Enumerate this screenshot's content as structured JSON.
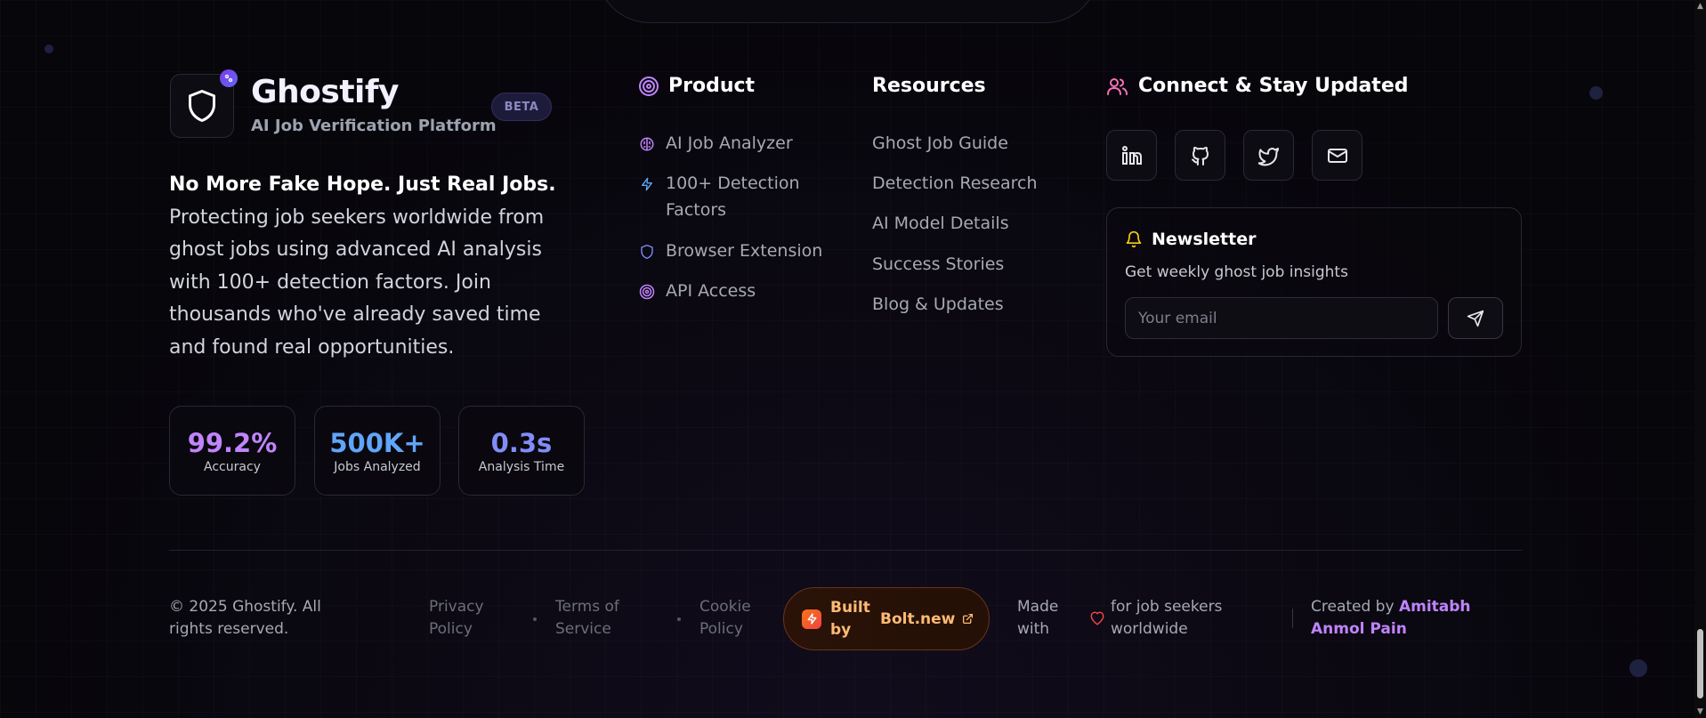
{
  "brand": {
    "name": "Ghostify",
    "tagline": "AI Job Verification Platform",
    "beta": "BETA",
    "headline": "No More Fake Hope. Just Real Jobs.",
    "description": "Protecting job seekers worldwide from ghost jobs using advanced AI analysis with 100+ detection factors. Join thousands who've already saved time and found real opportunities."
  },
  "stats": [
    {
      "value": "99.2%",
      "label": "Accuracy",
      "color": "#c084fc"
    },
    {
      "value": "500K+",
      "label": "Jobs Analyzed",
      "color": "#60a5fa"
    },
    {
      "value": "0.3s",
      "label": "Analysis Time",
      "color": "#818cf8"
    }
  ],
  "product": {
    "title": "Product",
    "items": [
      {
        "label": "AI Job Analyzer",
        "icon": "brain-icon"
      },
      {
        "label": "100+ Detection Factors",
        "icon": "zap-icon"
      },
      {
        "label": "Browser Extension",
        "icon": "shield-icon"
      },
      {
        "label": "API Access",
        "icon": "target-icon"
      }
    ]
  },
  "resources": {
    "title": "Resources",
    "items": [
      "Ghost Job Guide",
      "Detection Research",
      "AI Model Details",
      "Success Stories",
      "Blog & Updates"
    ]
  },
  "connect": {
    "title": "Connect & Stay Updated",
    "socials": [
      "linkedin-icon",
      "github-icon",
      "twitter-icon",
      "mail-icon"
    ]
  },
  "newsletter": {
    "title": "Newsletter",
    "subtitle": "Get weekly ghost job insights",
    "placeholder": "Your email"
  },
  "footer": {
    "copyright": "© 2025 Ghostify. All rights reserved.",
    "privacy": "Privacy Policy",
    "terms": "Terms of Service",
    "cookie": "Cookie Policy",
    "built_by": "Built by",
    "bolt": "Bolt.new",
    "made_with": "Made with",
    "made_for": "for job seekers worldwide",
    "created_by": "Created by",
    "creator": "Amitabh Anmol Pain"
  },
  "colors": {
    "accent_purple": "#c084fc",
    "accent_blue": "#60a5fa",
    "accent_orange": "#fdba74",
    "background": "#07060b"
  }
}
